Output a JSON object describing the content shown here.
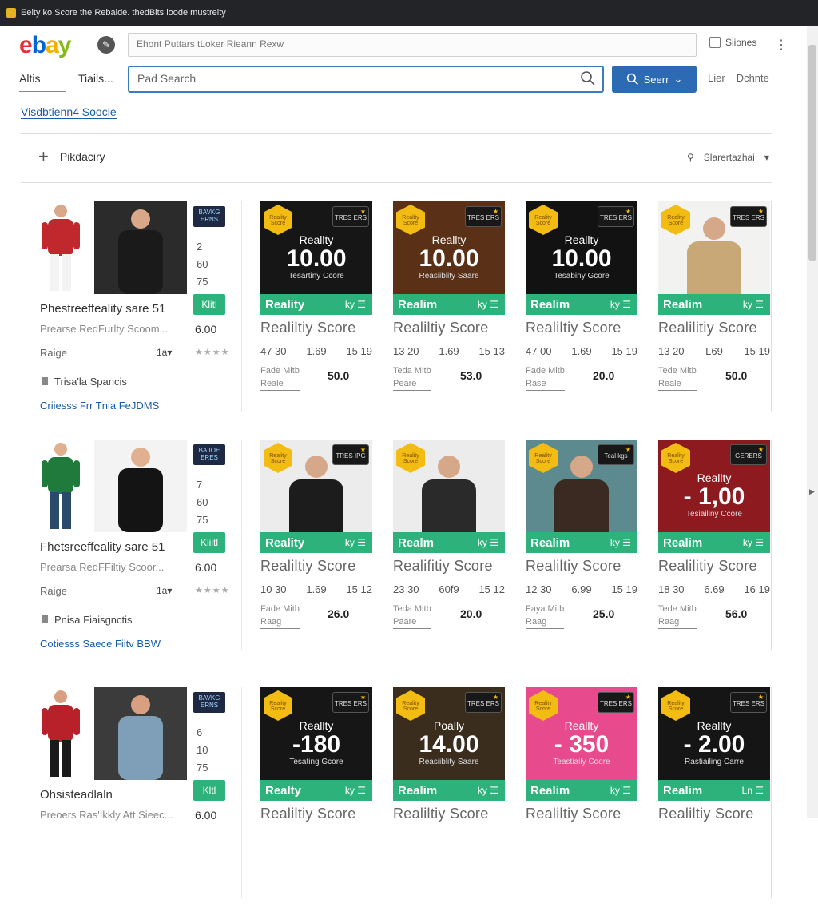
{
  "browser": {
    "tab_text": "Eelty ko Score the Rebalde. thedBits loode mustrelty"
  },
  "header": {
    "logo": "ebay",
    "top_search_placeholder": "Ehont Puttars tLoker Rieann Rexw",
    "saves_label": "Siiones",
    "nav_left_1": "Altis",
    "nav_left_2": "Tiails...",
    "search_placeholder": "Pad Search",
    "search_button": "Seerr",
    "nav_right_1": "Lier",
    "nav_right_2": "Dchnte",
    "sub_link": "Visdbtienn4 Soocie"
  },
  "toolbar": {
    "filter_label": "Pikdaciry",
    "sort_label": "Slarertazhai"
  },
  "colors": {
    "accent": "#2db27b",
    "brand_blue": "#2c6ab3",
    "badge_gold": "#f3bc12"
  },
  "rows": [
    {
      "left": {
        "badge": "BAVKG ERNS",
        "nums": [
          "2",
          "60",
          "75"
        ],
        "green": "Klitl",
        "title": "Phestreeffeality sare 51",
        "sub": "Prearse RedFurlty Scoom...",
        "price": "6.00",
        "range": "Raige",
        "one": "1a▾",
        "stars": "★★★★",
        "tag": "Trisa'la Spancis",
        "link": "Criiesss Frr Tnia FeJDMS"
      },
      "cards": [
        {
          "hex": "Reality Score",
          "tag": "TRES ERS",
          "ov_label": "Reallty",
          "ov_value": "10.00",
          "ov_sub": "Tesartiny Ccore",
          "bar": "Reality",
          "bar_r": "ky  ☰",
          "title": "Realiltiy Score",
          "s1": "47 30",
          "s2": "1.69",
          "s3": "15 19",
          "t1": "Fade Mitb",
          "t2": "Reale",
          "price": "50.0",
          "bg": "#161616"
        },
        {
          "hex": "Reality Score",
          "tag": "TRES ERS",
          "ov_label": "Reallty",
          "ov_value": "10.00",
          "ov_sub": "Reasiiblity Saare",
          "bar": "Realim",
          "bar_r": "ky  ☰",
          "title": "Realiltiy Score",
          "s1": "13 20",
          "s2": "1.69",
          "s3": "15 13",
          "t1": "Teda Mitb",
          "t2": "Peare",
          "price": "53.0",
          "bg": "#5a3016"
        },
        {
          "hex": "Reality Score",
          "tag": "TRES ERS",
          "ov_label": "Reallty",
          "ov_value": "10.00",
          "ov_sub": "Tesabiny Gcore",
          "bar": "Realim",
          "bar_r": "ky  ☰",
          "title": "Realiltiy Score",
          "s1": "47 00",
          "s2": "1.69",
          "s3": "15 19",
          "t1": "Fade Mitb",
          "t2": "Rase",
          "price": "20.0",
          "bg": "#121212"
        },
        {
          "hex": "Reality Score",
          "tag": "TRES ERS",
          "ov_label": "",
          "ov_value": "",
          "ov_sub": "",
          "bar": "Realim",
          "bar_r": "ky  ☰",
          "title": "Realilitiy Score",
          "s1": "13 20",
          "s2": "L69",
          "s3": "15 19",
          "t1": "Tede Mitb",
          "t2": "Reale",
          "price": "50.0",
          "bg": "#f2f2f0"
        }
      ]
    },
    {
      "left": {
        "badge": "BAIIOE ERES",
        "nums": [
          "7",
          "60",
          "75"
        ],
        "green": "Kliitl",
        "title": "Fhetsreeffeality sare 51",
        "sub": "Prearsa RedFFiltiy Scoor...",
        "price": "6.00",
        "range": "Raige",
        "one": "1a▾",
        "stars": "★★★★",
        "tag": "Pnisa Fiaisgnctis",
        "link": "Cotiesss Saece Fiitv BBW"
      },
      "cards": [
        {
          "hex": "Reality Score",
          "tag": "TRES IPG",
          "ov_label": "",
          "ov_value": "",
          "ov_sub": "",
          "bar": "Reality",
          "bar_r": "ky  ☰",
          "title": "Realiltiy Score",
          "s1": "10 30",
          "s2": "1.69",
          "s3": "15 12",
          "t1": "Fade Mitb",
          "t2": "Raag",
          "price": "26.0",
          "bg": "#ececec"
        },
        {
          "hex": "Reality Score",
          "tag": "",
          "ov_label": "",
          "ov_value": "",
          "ov_sub": "",
          "bar": "Realm",
          "bar_r": "ky  ☰",
          "title": "Realifitiy Score",
          "s1": "23 30",
          "s2": "60f9",
          "s3": "15 12",
          "t1": "Teda Mitb",
          "t2": "Paare",
          "price": "20.0",
          "bg": "#ececec"
        },
        {
          "hex": "Reality Score",
          "tag": "Teal kgs",
          "ov_label": "",
          "ov_value": "",
          "ov_sub": "",
          "bar": "Realim",
          "bar_r": "ky  ☰",
          "title": "Realiltiy Score",
          "s1": "12 30",
          "s2": "6.99",
          "s3": "15 19",
          "t1": "Faya Mitb",
          "t2": "Raag",
          "price": "25.0",
          "bg": "#5c8a8e"
        },
        {
          "hex": "Reality Score",
          "tag": "GERERS",
          "ov_label": "Reallty",
          "ov_value": "- 1,00",
          "ov_sub": "Tesiailiny Ccore",
          "bar": "Realim",
          "bar_r": "ky  ☰",
          "title": "Realilitiy Score",
          "s1": "18 30",
          "s2": "6.69",
          "s3": "16 19",
          "t1": "Tede Mitb",
          "t2": "Raag",
          "price": "56.0",
          "bg": "#8c1a1e"
        }
      ]
    },
    {
      "left": {
        "badge": "BAVKG ERNS",
        "nums": [
          "6",
          "10",
          "75"
        ],
        "green": "Kltl",
        "title": "Ohsisteadlaln",
        "sub": "Preoers Ras'Ikkly Att Sieec...",
        "price": "6.00",
        "range": "",
        "one": "",
        "stars": "",
        "tag": "",
        "link": ""
      },
      "cards": [
        {
          "hex": "Reality Score",
          "tag": "TRES ERS",
          "ov_label": "Reallty",
          "ov_value": "-180",
          "ov_sub": "Tesating Gcore",
          "bar": "Realty",
          "bar_r": "ky  ☰",
          "title": "Realiltiy Score",
          "s1": "",
          "s2": "",
          "s3": "",
          "t1": "",
          "t2": "",
          "price": "",
          "bg": "#161616"
        },
        {
          "hex": "Reality Score",
          "tag": "TRES ERS",
          "ov_label": "Poally",
          "ov_value": "14.00",
          "ov_sub": "Reasiiblity Saare",
          "bar": "Realim",
          "bar_r": "ky  ☰",
          "title": "Realiltiy Score",
          "s1": "",
          "s2": "",
          "s3": "",
          "t1": "",
          "t2": "",
          "price": "",
          "bg": "#3a2d1d"
        },
        {
          "hex": "Reality Score",
          "tag": "TRES ERS",
          "ov_label": "Reallty",
          "ov_value": "- 350",
          "ov_sub": "Teastiaily Coore",
          "bar": "Realim",
          "bar_r": "ky  ☰",
          "title": "Realiltiy Score",
          "s1": "",
          "s2": "",
          "s3": "",
          "t1": "",
          "t2": "",
          "price": "",
          "bg": "#e84a8e"
        },
        {
          "hex": "Reality Score",
          "tag": "TRES ERS",
          "ov_label": "Reallty",
          "ov_value": "- 2.00",
          "ov_sub": "Rastiailing Carre",
          "bar": "Realim",
          "bar_r": "Ln  ☰",
          "title": "Realiltiy Score",
          "s1": "",
          "s2": "",
          "s3": "",
          "t1": "",
          "t2": "",
          "price": "",
          "bg": "#151515"
        }
      ]
    }
  ]
}
